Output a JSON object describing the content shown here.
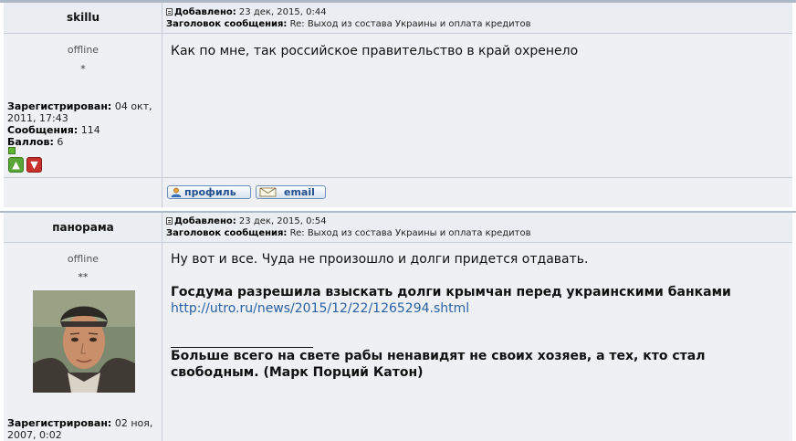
{
  "posts": [
    {
      "author": "skillu",
      "added_label": "Добавлено:",
      "added_value": "23 дек, 2015, 0:44",
      "subject_label": "Заголовок сообщения:",
      "subject_value": "Re: Выход из состава Украины и оплата кредитов",
      "status": "offline",
      "rank": "*",
      "registered_label": "Зарегистрирован:",
      "registered_value": "04 окт, 2011, 17:43",
      "messages_label": "Сообщения:",
      "messages_value": "114",
      "points_label": "Баллов:",
      "points_value": "6",
      "message": "Как по мне, так российское правительство в край охренело",
      "buttons": {
        "profile": "профиль",
        "email": "email"
      }
    },
    {
      "author": "панорама",
      "added_label": "Добавлено:",
      "added_value": "23 дек, 2015, 0:54",
      "subject_label": "Заголовок сообщения:",
      "subject_value": "Re: Выход из состава Украины и оплата кредитов",
      "status": "offline",
      "rank": "**",
      "registered_label": "Зарегистрирован:",
      "registered_value": "02 ноя, 2007, 0:02",
      "message_line1": "Ну вот и все. Чуда не произошло и долги придется отдавать.",
      "message_headline": "Госдума разрешила взыскать долги крымчан перед украинскими банками",
      "message_link": "http://utro.ru/news/2015/12/22/1265294.shtml",
      "signature": "Больше всего на свете рабы ненавидят не своих хозяев, а тех, кто стал свободным. (Марк Порций Катон)"
    }
  ],
  "icons": {
    "post": "post-icon",
    "online_indicator": "green-square-icon",
    "vote_up": "thumbs-up-icon",
    "vote_down": "thumbs-down-icon",
    "profile": "profile-icon",
    "email": "envelope-icon"
  },
  "colors": {
    "background": "#eef0f3",
    "border": "#c6cdd6",
    "link": "#2a62a4",
    "button_text": "#1f4f8e"
  }
}
